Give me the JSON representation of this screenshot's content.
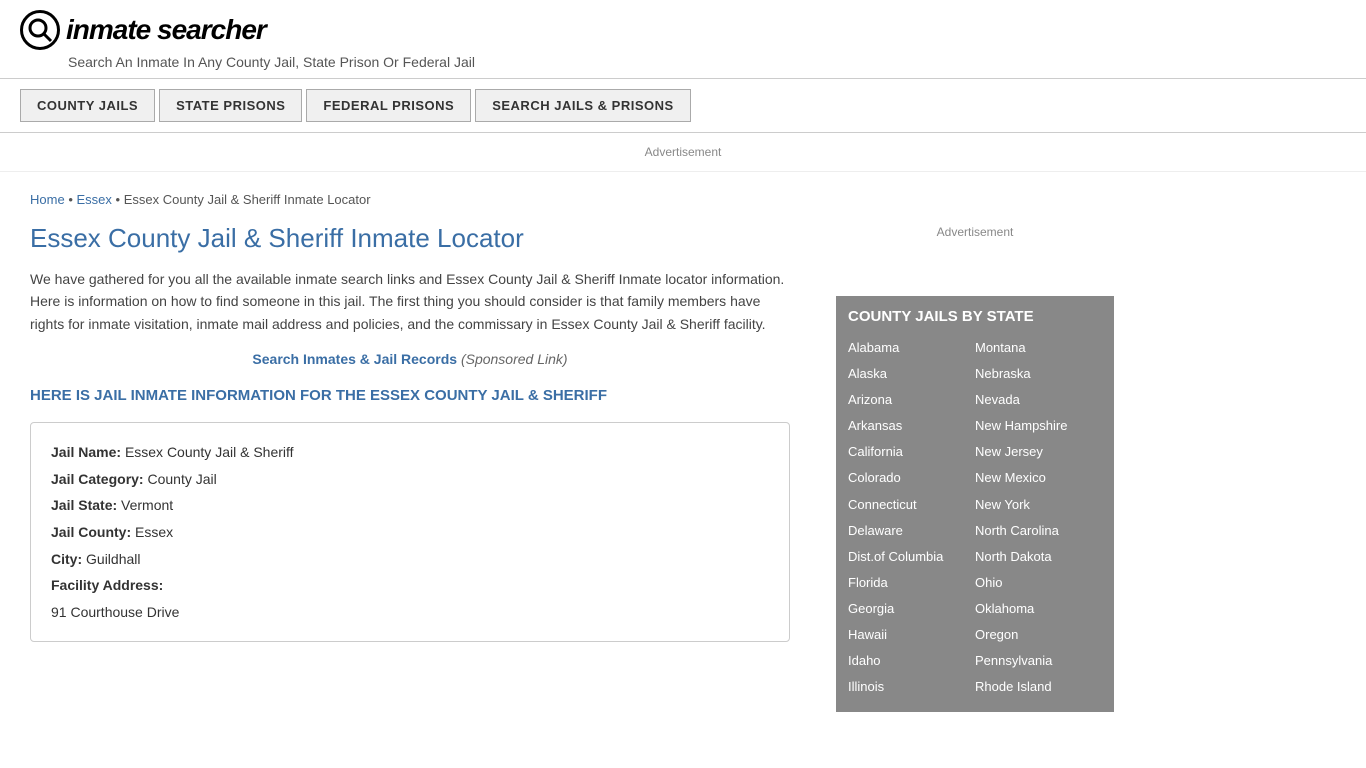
{
  "header": {
    "logo_icon": "Q",
    "logo_text": "inmate searcher",
    "tagline": "Search An Inmate In Any County Jail, State Prison Or Federal Jail"
  },
  "nav": {
    "buttons": [
      {
        "label": "COUNTY JAILS",
        "id": "county-jails-btn"
      },
      {
        "label": "STATE PRISONS",
        "id": "state-prisons-btn"
      },
      {
        "label": "FEDERAL PRISONS",
        "id": "federal-prisons-btn"
      },
      {
        "label": "SEARCH JAILS & PRISONS",
        "id": "search-jails-btn"
      }
    ]
  },
  "ad_banner": {
    "label": "Advertisement"
  },
  "breadcrumb": {
    "home": "Home",
    "essex": "Essex",
    "current": "Essex County Jail & Sheriff Inmate Locator"
  },
  "page": {
    "title": "Essex County Jail & Sheriff Inmate Locator",
    "description": "We have gathered for you all the available inmate search links and Essex County Jail & Sheriff Inmate locator information. Here is information on how to find someone in this jail. The first thing you should consider is that family members have rights for inmate visitation, inmate mail address and policies, and the commissary in Essex County Jail & Sheriff facility.",
    "sponsored_link_text": "Search Inmates & Jail Records",
    "sponsored_label": "(Sponsored Link)",
    "section_heading": "HERE IS JAIL INMATE INFORMATION FOR THE ESSEX COUNTY JAIL & SHERIFF"
  },
  "jail_info": {
    "name_label": "Jail Name:",
    "name_value": "Essex County Jail & Sheriff",
    "category_label": "Jail Category:",
    "category_value": "County Jail",
    "state_label": "Jail State:",
    "state_value": "Vermont",
    "county_label": "Jail County:",
    "county_value": "Essex",
    "city_label": "City:",
    "city_value": "Guildhall",
    "address_label": "Facility Address:",
    "address_value": "91 Courthouse Drive"
  },
  "sidebar": {
    "ad_label": "Advertisement",
    "widget_title": "COUNTY JAILS BY STATE",
    "states_left": [
      "Alabama",
      "Alaska",
      "Arizona",
      "Arkansas",
      "California",
      "Colorado",
      "Connecticut",
      "Delaware",
      "Dist.of Columbia",
      "Florida",
      "Georgia",
      "Hawaii",
      "Idaho",
      "Illinois"
    ],
    "states_right": [
      "Montana",
      "Nebraska",
      "Nevada",
      "New Hampshire",
      "New Jersey",
      "New Mexico",
      "New York",
      "North Carolina",
      "North Dakota",
      "Ohio",
      "Oklahoma",
      "Oregon",
      "Pennsylvania",
      "Rhode Island"
    ]
  }
}
